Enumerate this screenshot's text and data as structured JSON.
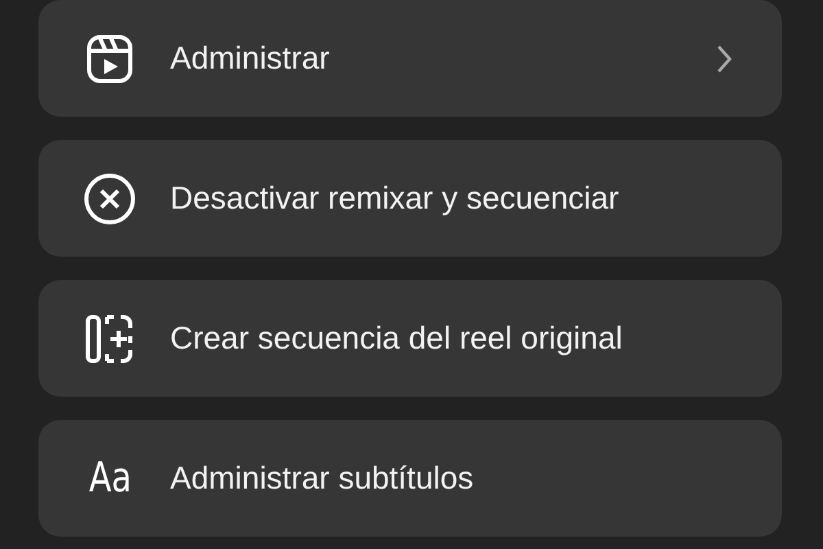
{
  "items": [
    {
      "kind": "reel",
      "label": "Administrar",
      "chevron": true
    },
    {
      "kind": "cancel",
      "label": "Desactivar remixar y secuenciar",
      "chevron": false
    },
    {
      "kind": "sequence",
      "label": "Crear secuencia del reel original",
      "chevron": false
    },
    {
      "kind": "text",
      "icon_text": "Aa",
      "label": "Administrar subtítulos",
      "chevron": false
    }
  ]
}
